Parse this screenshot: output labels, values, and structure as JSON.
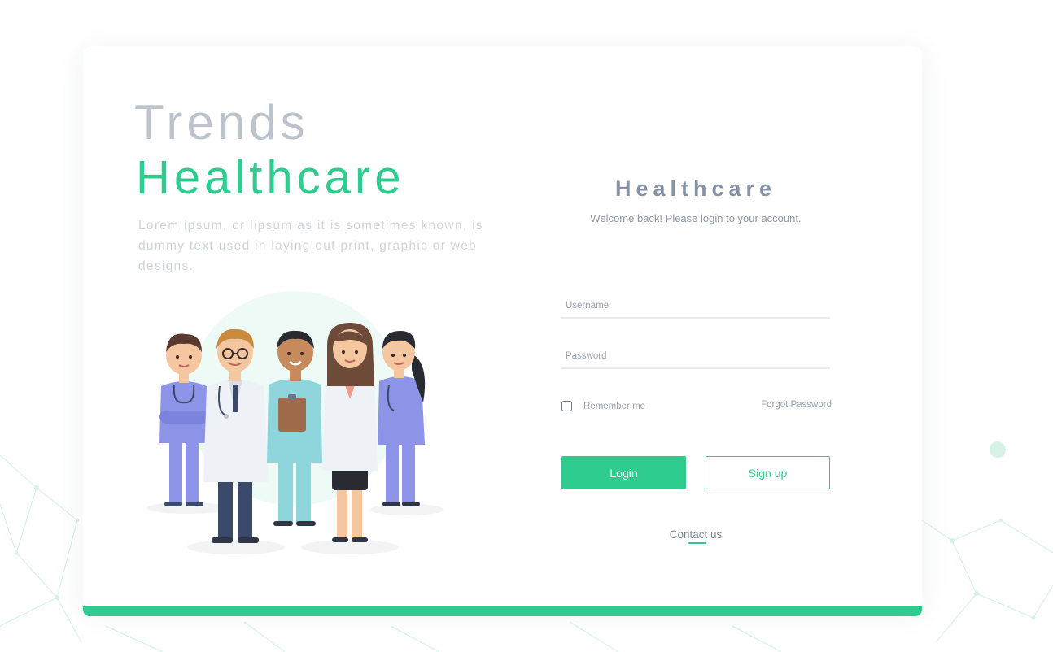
{
  "colors": {
    "accent": "#2ecc8f",
    "title_light": "#bcc3cb",
    "brand_text": "#8792a6",
    "muted_text": "#9aa2ad"
  },
  "hero": {
    "title_line1": "Trends",
    "title_line2": "Healthcare",
    "description": "Lorem ipsum, or lipsum as it is sometimes known, is dummy text used in laying out print, graphic or web designs."
  },
  "illustration": {
    "icon": "medical-team-illustration"
  },
  "login": {
    "brand": "Healthcare",
    "welcome": "Welcome back! Please login to your account.",
    "username_placeholder": "Username",
    "password_placeholder": "Password",
    "remember_label": "Remember me",
    "remember_checked": false,
    "forgot_label": "Forgot Password",
    "login_label": "Login",
    "signup_label": "Sign up",
    "contact_label": "Contact us"
  }
}
